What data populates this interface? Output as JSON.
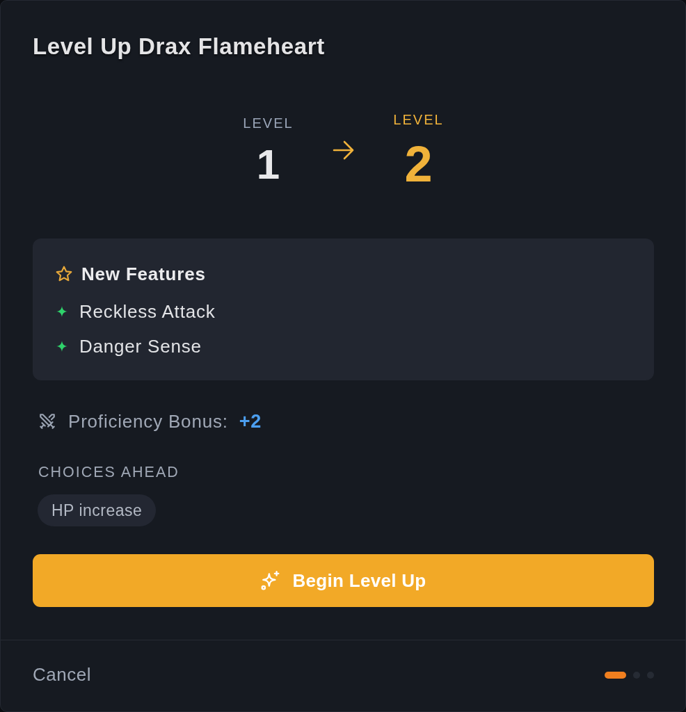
{
  "dialog": {
    "title": "Level Up Drax Flameheart"
  },
  "level_change": {
    "from": {
      "label": "LEVEL",
      "value": "1"
    },
    "to": {
      "label": "LEVEL",
      "value": "2"
    }
  },
  "new_features": {
    "heading": "New Features",
    "items": [
      "Reckless Attack",
      "Danger Sense"
    ]
  },
  "proficiency": {
    "label": "Proficiency Bonus:",
    "value": "+2"
  },
  "choices": {
    "heading": "CHOICES AHEAD",
    "chips": [
      "HP increase"
    ]
  },
  "primary_button": {
    "label": "Begin Level Up"
  },
  "footer": {
    "cancel": "Cancel",
    "steps": [
      {
        "selected": true
      },
      {
        "selected": false
      },
      {
        "selected": false
      }
    ]
  }
}
